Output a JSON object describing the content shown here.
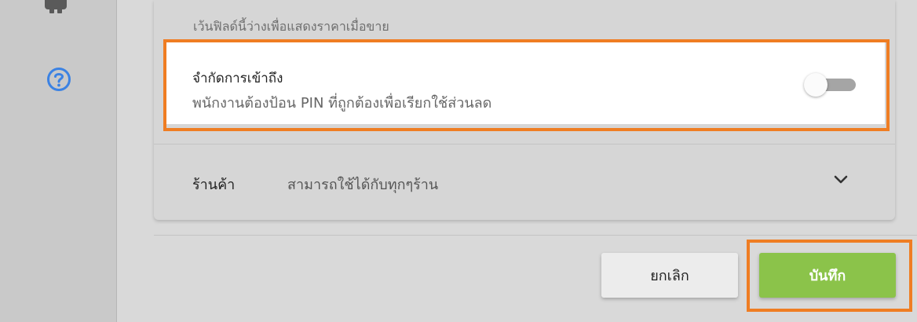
{
  "sidebar": {
    "icons": [
      "gear-icon",
      "help-icon"
    ]
  },
  "price_field": {
    "hint": "เว้นฟิลด์นี้ว่างเพื่อแสดงราคาเมื่อขาย"
  },
  "restrict_access": {
    "title": "จำกัดการเข้าถึง",
    "description": "พนักงานต้องป้อน PIN ที่ถูกต้องเพื่อเรียกใช้ส่วนลด",
    "enabled": false
  },
  "stores": {
    "label": "ร้านค้า",
    "value": "สามารถใช้ได้กับทุกๆร้าน"
  },
  "footer": {
    "cancel_label": "ยกเลิก",
    "save_label": "บันทึก"
  },
  "colors": {
    "accent": "#4287e6",
    "save": "#8bc34a",
    "highlight": "#ef7d23"
  }
}
